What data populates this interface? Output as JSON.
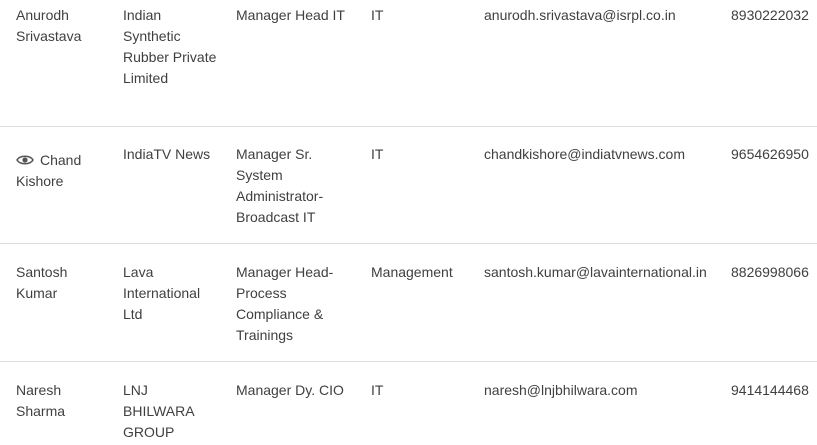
{
  "rows": [
    {
      "name": "Anurodh Srivastava",
      "company": "Indian Synthetic Rubber Private Limited",
      "designation": "Manager Head IT",
      "department": "IT",
      "email": "anurodh.srivastava@isrpl.co.in",
      "phone": "8930222032"
    },
    {
      "icon": "eye-icon",
      "name": "Chand Kishore",
      "company": "IndiaTV News",
      "designation": "Manager Sr. System Administrator-Broadcast IT",
      "department": "IT",
      "email": "chandkishore@indiatvnews.com",
      "phone": "9654626950"
    },
    {
      "name": "Santosh Kumar",
      "company": "Lava International Ltd",
      "designation": "Manager Head-Process Compliance & Trainings",
      "department": "Management",
      "email": "santosh.kumar@lavainternational.in",
      "phone": "8826998066"
    },
    {
      "name": "Naresh Sharma",
      "company": "LNJ BHILWARA GROUP",
      "designation": "Manager Dy. CIO",
      "department": "IT",
      "email": "naresh@lnjbhilwara.com",
      "phone": "9414144468"
    }
  ]
}
